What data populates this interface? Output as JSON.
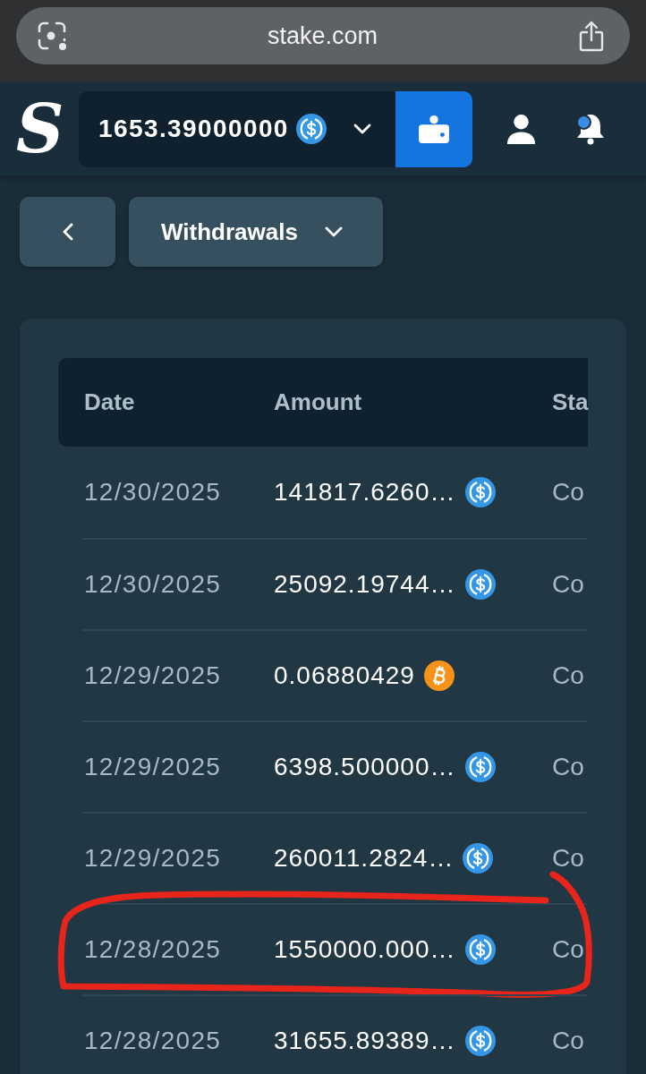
{
  "browser": {
    "url": "stake.com"
  },
  "header": {
    "logo": "S",
    "balance": "1653.39000000",
    "notifications": {
      "unread": true
    }
  },
  "toolbar": {
    "filter": "Withdrawals"
  },
  "table": {
    "columns": [
      "Date",
      "Amount",
      "Sta"
    ],
    "rows": [
      {
        "date": "12/30/2025",
        "amount": "141817.6260…",
        "kind": "usdc",
        "status": "Co",
        "circled": false
      },
      {
        "date": "12/30/2025",
        "amount": "25092.19744…",
        "kind": "usdc",
        "status": "Co",
        "circled": false
      },
      {
        "date": "12/29/2025",
        "amount": "0.06880429",
        "kind": "btc",
        "status": "Co",
        "circled": false
      },
      {
        "date": "12/29/2025",
        "amount": "6398.500000…",
        "kind": "usdc",
        "status": "Co",
        "circled": false
      },
      {
        "date": "12/29/2025",
        "amount": "260011.2824…",
        "kind": "usdc",
        "status": "Co",
        "circled": false
      },
      {
        "date": "12/28/2025",
        "amount": "1550000.000…",
        "kind": "usdc",
        "status": "Co",
        "circled": true
      },
      {
        "date": "12/28/2025",
        "amount": "31655.89389…",
        "kind": "usdc",
        "status": "Co",
        "circled": false
      }
    ]
  }
}
